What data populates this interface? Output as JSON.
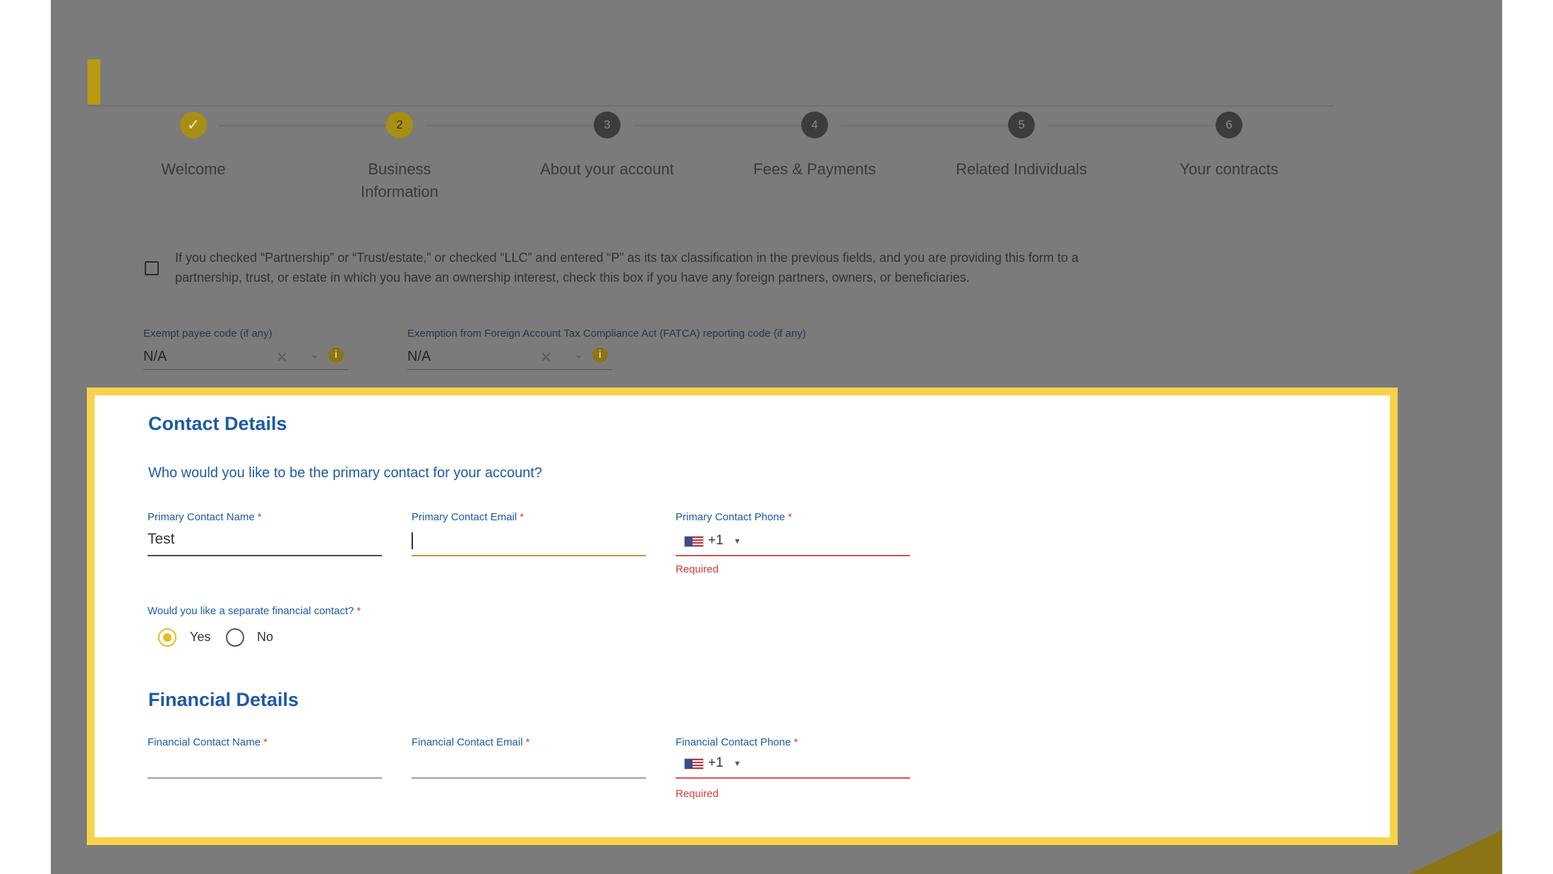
{
  "stepper": {
    "steps": [
      {
        "number": "✓",
        "label": "Welcome",
        "state": "done"
      },
      {
        "number": "2",
        "label": "Business Information",
        "state": "active"
      },
      {
        "number": "3",
        "label": "About your account",
        "state": "idle"
      },
      {
        "number": "4",
        "label": "Fees & Payments",
        "state": "idle"
      },
      {
        "number": "5",
        "label": "Related Individuals",
        "state": "idle"
      },
      {
        "number": "6",
        "label": "Your contracts",
        "state": "idle"
      }
    ]
  },
  "background_form": {
    "foreign_partners_checkbox": {
      "checked": false,
      "text": "If you checked “Partnership” or “Trust/estate,” or checked “LLC” and entered “P” as its tax classification in the previous fields, and you are providing this form to a partnership, trust, or estate in which you have an ownership interest, check this box if you have any foreign partners, owners, or beneficiaries."
    },
    "exempt_payee": {
      "label": "Exempt payee code (if any)",
      "value": "N/A",
      "clear_icon": "close-icon",
      "dropdown_icon": "chevron-down-icon",
      "info_icon": "info-icon"
    },
    "fatca": {
      "label": "Exemption from Foreign Account Tax Compliance Act (FATCA) reporting code (if any)",
      "value": "N/A",
      "clear_icon": "close-icon",
      "dropdown_icon": "chevron-down-icon",
      "info_icon": "info-icon"
    }
  },
  "contact_details": {
    "title": "Contact Details",
    "question": "Who would you like to be the primary contact for your account?",
    "primary_name": {
      "label": "Primary Contact Name",
      "required_mark": "*",
      "value": "Test"
    },
    "primary_email": {
      "label": "Primary Contact Email",
      "required_mark": "*",
      "value": ""
    },
    "primary_phone": {
      "label": "Primary Contact Phone",
      "required_mark": "*",
      "country_code": "+1",
      "flag": "us-flag-icon",
      "error": "Required"
    },
    "separate_financial": {
      "label": "Would you like a separate financial contact?",
      "required_mark": "*",
      "options": [
        {
          "label": "Yes",
          "selected": true
        },
        {
          "label": "No",
          "selected": false
        }
      ]
    }
  },
  "financial_details": {
    "title": "Financial Details",
    "name": {
      "label": "Financial Contact Name",
      "required_mark": "*",
      "value": ""
    },
    "email": {
      "label": "Financial Contact Email",
      "required_mark": "*",
      "value": ""
    },
    "phone": {
      "label": "Financial Contact Phone",
      "required_mark": "*",
      "country_code": "+1",
      "flag": "us-flag-icon",
      "error": "Required"
    }
  },
  "colors": {
    "highlight_border": "#f8d24b",
    "heading_blue": "#1d5aa5",
    "error_red": "#d23c3c",
    "radio_selected": "#e8b923",
    "overlay_gray": "#7b7b7b"
  }
}
